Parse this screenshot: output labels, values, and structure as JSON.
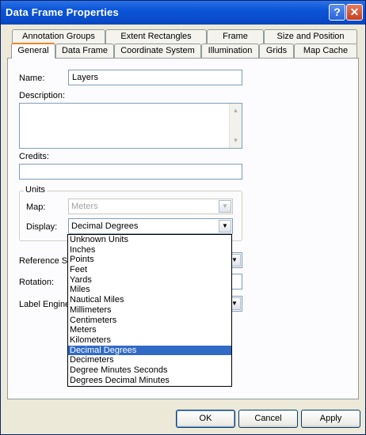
{
  "window": {
    "title": "Data Frame Properties",
    "help_glyph": "?",
    "close_glyph": "✕"
  },
  "tabs": {
    "back_row": [
      "Annotation Groups",
      "Extent Rectangles",
      "Frame",
      "Size and Position"
    ],
    "front_row": [
      "General",
      "Data Frame",
      "Coordinate System",
      "Illumination",
      "Grids",
      "Map Cache"
    ],
    "active": "General"
  },
  "general": {
    "name_label": "Name:",
    "name_value": "Layers",
    "description_label": "Description:",
    "description_value": "",
    "credits_label": "Credits:",
    "credits_value": "",
    "units_group_label": "Units",
    "map_label": "Map:",
    "map_value": "Meters",
    "display_label": "Display:",
    "display_value": "Decimal Degrees",
    "reference_scale_label": "Reference Sc",
    "rotation_label": "Rotation:",
    "label_engine_label": "Label Engine:"
  },
  "display_options": [
    "Unknown Units",
    "Inches",
    "Points",
    "Feet",
    "Yards",
    "Miles",
    "Nautical Miles",
    "Millimeters",
    "Centimeters",
    "Meters",
    "Kilometers",
    "Decimal Degrees",
    "Decimeters",
    "Degree Minutes Seconds",
    "Degrees Decimal Minutes"
  ],
  "selected_option": "Decimal Degrees",
  "buttons": {
    "ok": "OK",
    "cancel": "Cancel",
    "apply": "Apply"
  },
  "icons": {
    "dropdown": "chevron-down-icon",
    "scroll_up": "arrow-up-icon",
    "scroll_down": "arrow-down-icon"
  },
  "colors": {
    "title_bar": "#0a54d8",
    "selection": "#316ac5",
    "active_tab_accent": "#e68b2c"
  }
}
